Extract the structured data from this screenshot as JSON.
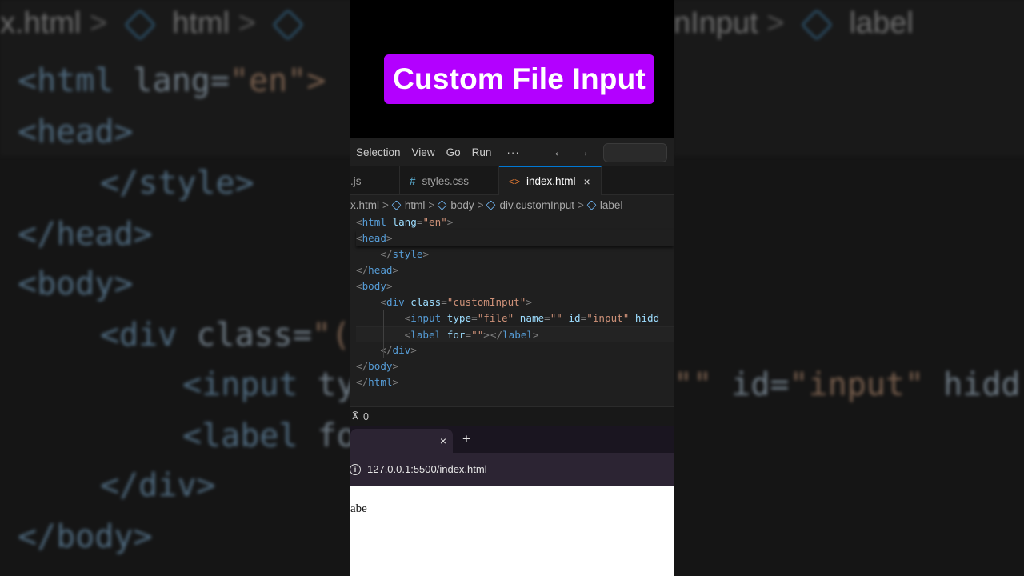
{
  "title_badge": "Custom File Input",
  "background": {
    "crumb_left": "x.html",
    "crumb_html": "html",
    "crumb_right1": "nInput",
    "crumb_right2": "label",
    "lines": {
      "l1_tag": "<html",
      "l1_attr": " lang=",
      "l1_str": "\"en\">",
      "l2": "<head>",
      "l3": "</style>",
      "l4": "</head>",
      "l5": "<body>",
      "l6_tag": "<div",
      "l6_attr": " class=",
      "l6_str": "\"(",
      "l7_tag": "<input",
      "l7_attr": " ty",
      "l8_tag": "<label",
      "l8_attr": " fo",
      "l9": "</div>",
      "l10": "</body>",
      "r7_str": "\"\"",
      "r7_attr": " id=",
      "r7_str2": "\"input\"",
      "r7_tail": " hidd"
    }
  },
  "menubar": {
    "items": [
      "Selection",
      "View",
      "Go",
      "Run"
    ],
    "more": "···",
    "back": "←",
    "forward": "→"
  },
  "tabs": {
    "tab1": ".js",
    "tab2_icon": "#",
    "tab2": "styles.css",
    "tab3_icon": "<>",
    "tab3": "index.html",
    "close": "×"
  },
  "breadcrumbs": {
    "file": "x.html",
    "items": [
      "html",
      "body",
      "div.customInput",
      "label"
    ],
    "sep": ">"
  },
  "code": {
    "line1": {
      "open": "<",
      "tag": "html",
      "attr": " lang",
      "eq": "=",
      "val": "\"en\"",
      "close": ">"
    },
    "line2": {
      "open": "<",
      "tag": "head",
      "close": ">"
    },
    "line3": {
      "indent": "    ",
      "open": "</",
      "tag": "style",
      "close": ">"
    },
    "line4": {
      "open": "</",
      "tag": "head",
      "close": ">"
    },
    "line5": {
      "open": "<",
      "tag": "body",
      "close": ">"
    },
    "line6": {
      "indent": "    ",
      "open": "<",
      "tag": "div",
      "attr": " class",
      "eq": "=",
      "val": "\"customInput\"",
      "close": ">"
    },
    "line7": {
      "indent": "        ",
      "open": "<",
      "tag": "input",
      "a1": " type",
      "eq1": "=",
      "v1": "\"file\"",
      "a2": " name",
      "eq2": "=",
      "v2": "\"\"",
      "a3": " id",
      "eq3": "=",
      "v3": "\"input\"",
      "a4": " hidd"
    },
    "line8": {
      "indent": "        ",
      "open": "<",
      "tag": "label",
      "attr": " for",
      "eq": "=",
      "val": "\"\"",
      "close": ">",
      "open2": "</",
      "tag2": "label",
      "close2": ">"
    },
    "line9": {
      "indent": "    ",
      "open": "</",
      "tag": "div",
      "close": ">"
    },
    "line10": {
      "open": "</",
      "tag": "body",
      "close": ">"
    },
    "line11": {
      "open": "</",
      "tag": "html",
      "close": ">"
    }
  },
  "statusbar": {
    "ports_icon": "antenna-icon",
    "ports_count": "0"
  },
  "browser": {
    "tab_close": "×",
    "new_tab": "+",
    "info_icon": "i",
    "url": "127.0.0.1:5500/index.html",
    "page_text": "abe"
  }
}
